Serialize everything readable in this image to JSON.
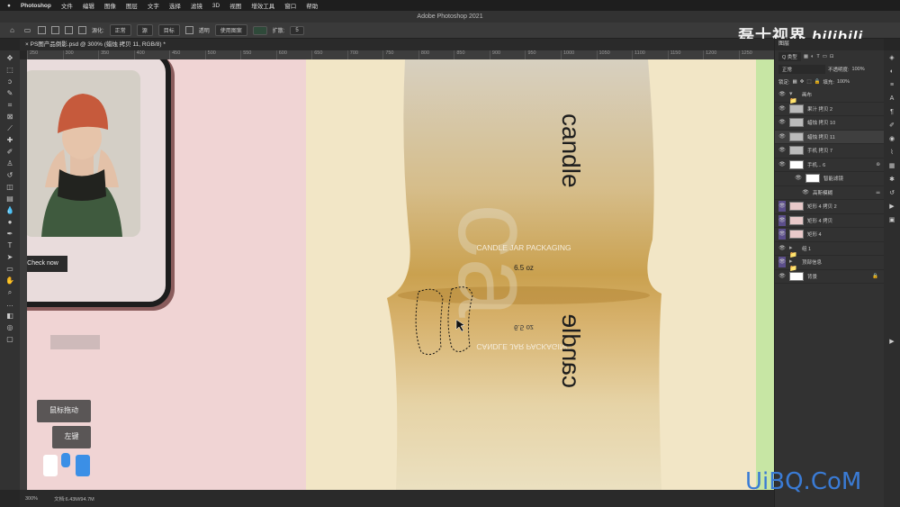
{
  "macmenu": [
    "Photoshop",
    "文件",
    "编辑",
    "图像",
    "图层",
    "文字",
    "选择",
    "滤镜",
    "3D",
    "视图",
    "增效工具",
    "窗口",
    "帮助"
  ],
  "window_title": "Adobe Photoshop 2021",
  "options": {
    "feather_label": "源化:",
    "mode_label": "正常",
    "source_label": "源",
    "dest_label": "目标",
    "transparent_label": "透明",
    "use_pattern_label": "使用图案",
    "diffuse_label": "扩散:",
    "diffuse_value": "5"
  },
  "document_tab": "PS图产品倒影.psd @ 300% (蜡烛 拷贝 11, RGB/8) *",
  "ruler_ticks": [
    "250",
    "300",
    "350",
    "400",
    "450",
    "500",
    "550",
    "600",
    "650",
    "700",
    "750",
    "800",
    "850",
    "900",
    "950",
    "1000",
    "1050",
    "1100",
    "1150",
    "1200",
    "1250"
  ],
  "canvas": {
    "check_now": "Check now",
    "brand": "candle",
    "jar_title": "CANDLE JAR PACKAGING",
    "jar_weight": "6.5 oz",
    "jar_title_reflect": "CANDLE JAR PACKAGING",
    "jar_weight_reflect": "6.5 oz",
    "brand_reflect": "candle"
  },
  "captions": {
    "drag": "鼠标拖动",
    "left_key": "左键"
  },
  "watermark_top": "磊士视界",
  "watermark_bili": "bilibili",
  "watermark_bottom": "UiBQ.CoM",
  "layers_panel": {
    "title": "图层",
    "filter_label": "Q 类型",
    "blend_mode": "正常",
    "opacity_label": "不透明度:",
    "opacity_value": "100%",
    "lock_label": "锁定:",
    "fill_label": "填充:",
    "fill_value": "100%",
    "layers": [
      {
        "name": "画布",
        "type": "folder"
      },
      {
        "name": "果汁 拷贝 2",
        "type": "layer"
      },
      {
        "name": "蜡烛 拷贝 10",
        "type": "layer"
      },
      {
        "name": "蜡烛 拷贝 11",
        "type": "layer",
        "selected": true
      },
      {
        "name": "手机 拷贝 7",
        "type": "layer"
      },
      {
        "name": "手机... 6",
        "type": "smart"
      },
      {
        "name": "智能滤镜",
        "type": "filter"
      },
      {
        "name": "高斯模糊",
        "type": "filter-item"
      },
      {
        "name": "矩形 4 拷贝 2",
        "type": "layer",
        "purple": true
      },
      {
        "name": "矩形 4 拷贝",
        "type": "layer",
        "purple": true
      },
      {
        "name": "矩形 4",
        "type": "layer",
        "purple": true
      },
      {
        "name": "组 1",
        "type": "folder"
      },
      {
        "name": "顶部信息",
        "type": "folder",
        "purple": true
      },
      {
        "name": "背景",
        "type": "white"
      }
    ]
  },
  "status": {
    "zoom": "300%",
    "doc": "文档:6.43M/94.7M"
  }
}
